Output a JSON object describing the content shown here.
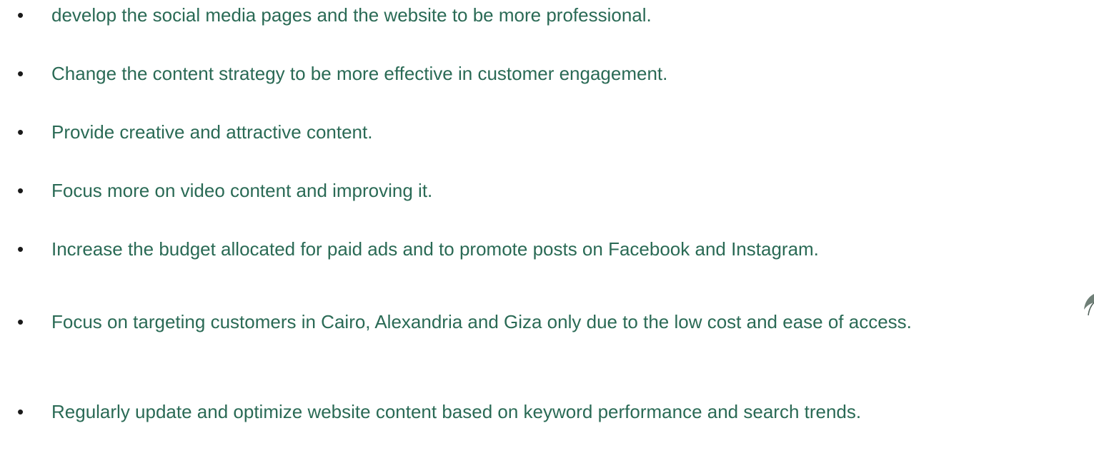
{
  "colors": {
    "text": "#2a6a55",
    "bullet": "#1a1a1a",
    "background": "#ffffff"
  },
  "bullet_symbol": "•",
  "bullets": [
    {
      "text": "develop the social media pages and the website to be more professional."
    },
    {
      "text": "Change the content strategy to be more effective in customer engagement."
    },
    {
      "text": "Provide creative and attractive content."
    },
    {
      "text": "Focus more on video content and improving it."
    },
    {
      "text": "Increase the budget allocated for paid ads and to promote posts on Facebook and Instagram."
    },
    {
      "text": "Focus on targeting customers in Cairo, Alexandria and Giza only due to the low cost and ease of access."
    },
    {
      "text": "Regularly update and optimize website content based on keyword performance and search trends."
    }
  ],
  "decoration_icon": "feather-icon"
}
